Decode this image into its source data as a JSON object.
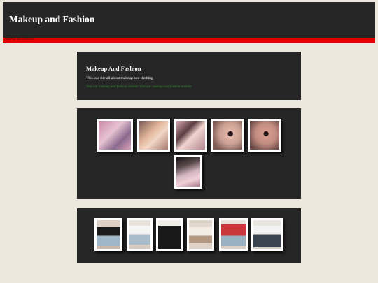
{
  "header": {
    "title": "Makeup and Fashion",
    "home_link": "Makeup and Fashion"
  },
  "intro": {
    "heading": "Makeup And Fashion",
    "description": "This is a site all about makeup and clothing",
    "tagline": "Visit our makeup and fashion website Visit our makeup and fashion website"
  },
  "galleries": {
    "makeup": [
      "makeup-photo",
      "makeup-photo",
      "makeup-photo",
      "makeup-photo",
      "makeup-photo",
      "makeup-photo"
    ],
    "fashion": [
      "outfit-photo",
      "outfit-photo",
      "outfit-photo",
      "outfit-photo",
      "outfit-photo",
      "outfit-photo"
    ]
  },
  "colors": {
    "background": "#ebe7dd",
    "panel": "#262626",
    "accent_bar": "#e50000",
    "tagline": "#2e8b2e"
  }
}
